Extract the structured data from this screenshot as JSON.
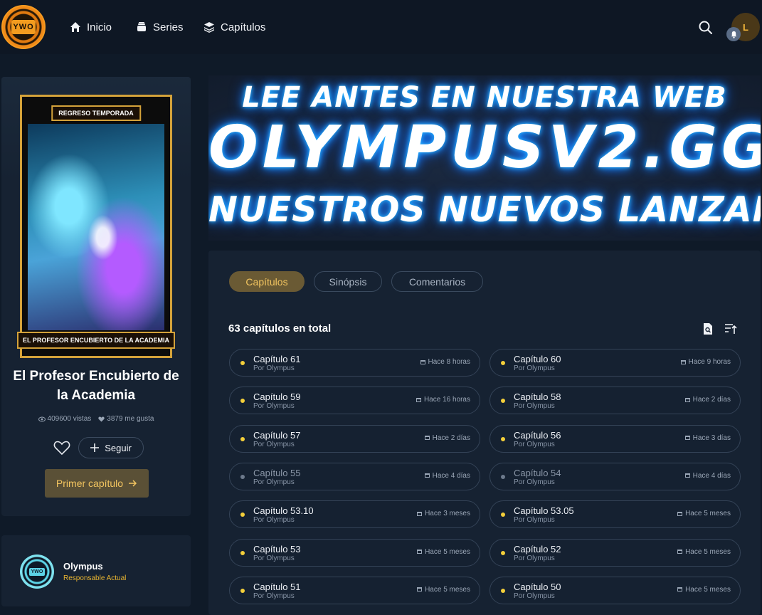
{
  "nav": {
    "logo_text": "YWO",
    "items": [
      {
        "label": "Inicio",
        "icon": "home-icon"
      },
      {
        "label": "Series",
        "icon": "layers-icon"
      },
      {
        "label": "Capítulos",
        "icon": "stack-icon"
      }
    ],
    "avatar_initial": "L"
  },
  "series": {
    "cover_top": "REGRESO TEMPORADA",
    "cover_bottom": "EL PROFESOR ENCUBIERTO DE LA ACADEMIA",
    "title": "El Profesor Encubierto de la Academia",
    "views": "409600 vistas",
    "likes": "3879 me gusta",
    "follow_label": "Seguir",
    "first_chapter_label": "Primer capítulo"
  },
  "uploader": {
    "avatar_text": "YWO",
    "name": "Olympus",
    "role": "Responsable Actual"
  },
  "banner": {
    "line1": "LEE ANTES EN NUESTRA WEB",
    "line2": "OLYMPUSV2.GG",
    "line3": "NUESTROS NUEVOS LANZAMIENTOS"
  },
  "tabs": [
    "Capítulos",
    "Sinópsis",
    "Comentarios"
  ],
  "chapters_total": "63 capítulos en total",
  "chapters": [
    {
      "name": "Capítulo 61",
      "by": "Por Olympus",
      "time": "Hace 8 horas",
      "new": true
    },
    {
      "name": "Capítulo 60",
      "by": "Por Olympus",
      "time": "Hace 9 horas",
      "new": true
    },
    {
      "name": "Capítulo 59",
      "by": "Por Olympus",
      "time": "Hace 16 horas",
      "new": true
    },
    {
      "name": "Capítulo 58",
      "by": "Por Olympus",
      "time": "Hace 2 días",
      "new": true
    },
    {
      "name": "Capítulo 57",
      "by": "Por Olympus",
      "time": "Hace 2 días",
      "new": true
    },
    {
      "name": "Capítulo 56",
      "by": "Por Olympus",
      "time": "Hace 3 días",
      "new": true
    },
    {
      "name": "Capítulo 55",
      "by": "Por Olympus",
      "time": "Hace 4 días",
      "new": false
    },
    {
      "name": "Capítulo 54",
      "by": "Por Olympus",
      "time": "Hace 4 días",
      "new": false
    },
    {
      "name": "Capítulo 53.10",
      "by": "Por Olympus",
      "time": "Hace 3 meses",
      "new": true
    },
    {
      "name": "Capítulo 53.05",
      "by": "Por Olympus",
      "time": "Hace 5 meses",
      "new": true
    },
    {
      "name": "Capítulo 53",
      "by": "Por Olympus",
      "time": "Hace 5 meses",
      "new": true
    },
    {
      "name": "Capítulo 52",
      "by": "Por Olympus",
      "time": "Hace 5 meses",
      "new": true
    },
    {
      "name": "Capítulo 51",
      "by": "Por Olympus",
      "time": "Hace 5 meses",
      "new": true
    },
    {
      "name": "Capítulo 50",
      "by": "Por Olympus",
      "time": "Hace 5 meses",
      "new": true
    }
  ],
  "colors": {
    "accent": "#f3c560",
    "background": "#0f1a28",
    "panel": "#162232"
  }
}
